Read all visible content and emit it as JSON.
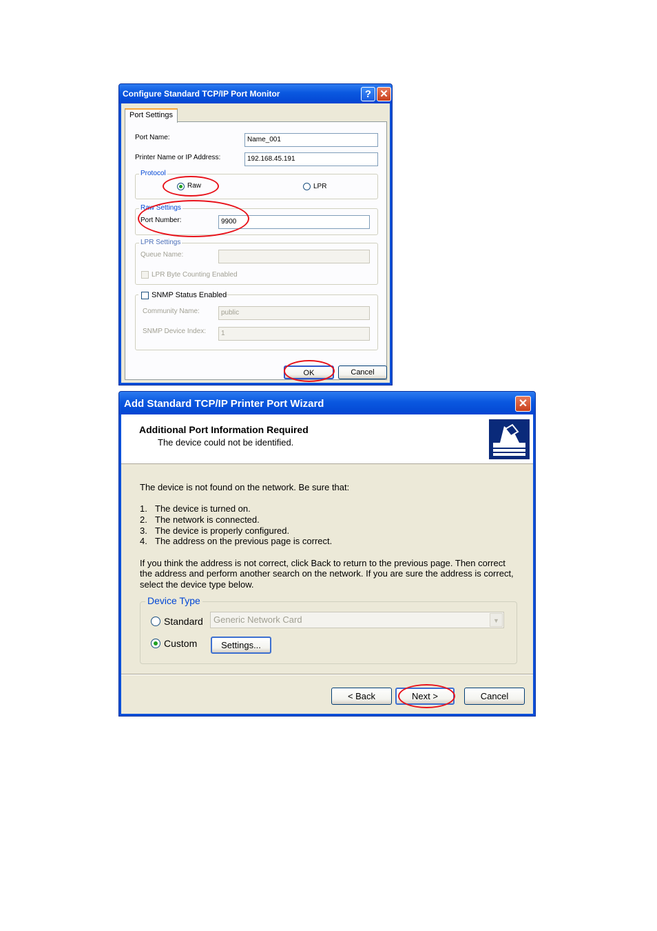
{
  "dialog1": {
    "title": "Configure Standard TCP/IP Port Monitor",
    "help_button": "?",
    "close_button": "✕",
    "tab": "Port Settings",
    "port_name_label": "Port Name:",
    "port_name_value": "Name_001",
    "printer_ip_label": "Printer Name or IP Address:",
    "printer_ip_value": "192.168.45.191",
    "protocol": {
      "title": "Protocol",
      "raw_label": "Raw",
      "lpr_label": "LPR",
      "selected": "Raw"
    },
    "raw_settings": {
      "title": "Raw Settings",
      "port_number_label": "Port Number:",
      "port_number_value": "9900"
    },
    "lpr_settings": {
      "title": "LPR Settings",
      "queue_name_label": "Queue Name:",
      "queue_name_value": "",
      "byte_counting_label": "LPR Byte Counting Enabled"
    },
    "snmp": {
      "enabled_label": "SNMP Status Enabled",
      "community_label": "Community Name:",
      "community_value": "public",
      "device_index_label": "SNMP Device Index:",
      "device_index_value": "1"
    },
    "ok_label": "OK",
    "cancel_label": "Cancel"
  },
  "dialog2": {
    "title": "Add Standard TCP/IP Printer Port Wizard",
    "close_button": "✕",
    "header_title": "Additional Port Information Required",
    "header_subtitle": "The device could not be identified.",
    "intro": "The device is not found on the network.  Be sure that:",
    "checklist": [
      {
        "num": "1.",
        "text": "The device is turned on."
      },
      {
        "num": "2.",
        "text": "The network is connected."
      },
      {
        "num": "3.",
        "text": "The device is properly configured."
      },
      {
        "num": "4.",
        "text": "The address on the previous page is correct."
      }
    ],
    "advice_lines": [
      "If you think the address is not correct, click Back to return to the previous page.  Then correct",
      "the address and perform another search on the network.  If you are sure the address is correct,",
      "select the device type below."
    ],
    "device_type": {
      "title": "Device Type",
      "standard_label": "Standard",
      "standard_value": "Generic Network Card",
      "custom_label": "Custom",
      "settings_label": "Settings...",
      "selected": "Custom"
    },
    "back_label": "< Back",
    "next_label": "Next >",
    "cancel_label": "Cancel"
  },
  "colors": {
    "titlebar": "#0A58E0",
    "dialog_face": "#ECE9D8",
    "groupbox_title": "#0046D5",
    "annotation_ring": "#E8121A"
  }
}
